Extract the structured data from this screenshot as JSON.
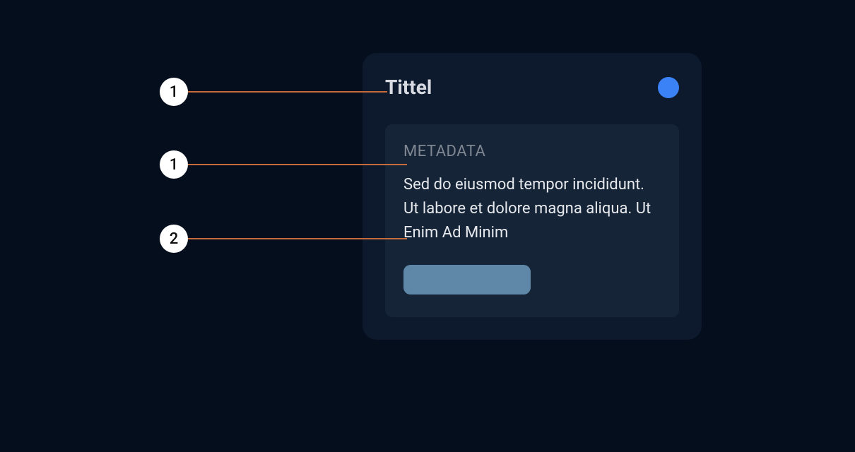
{
  "card": {
    "title": "Tittel",
    "panel": {
      "metadata_label": "METADATA",
      "description": "Sed do eiusmod tempor incididunt. Ut labore et dolore magna aliqua. Ut Enim Ad Minim"
    }
  },
  "annotations": {
    "marker1": "1",
    "marker2": "1",
    "marker3": "2"
  }
}
